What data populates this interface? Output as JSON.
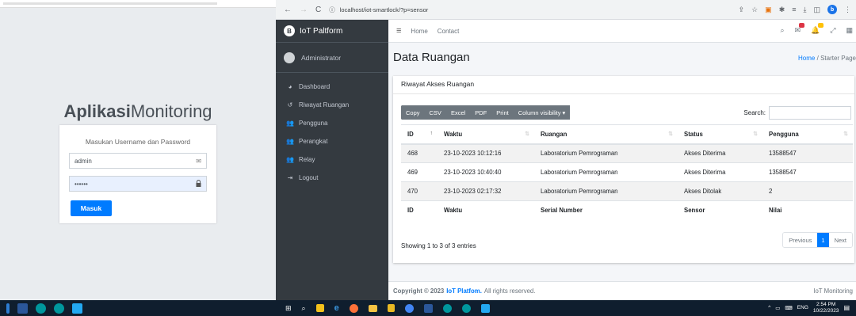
{
  "login": {
    "title_bold": "Aplikasi",
    "title_light": "Monitoring",
    "message": "Masukan Username dan Password",
    "username_value": "admin",
    "password_value": "••••••",
    "submit_label": "Masuk"
  },
  "browser": {
    "url": "localhost/iot-smartlock/?p=sensor",
    "profile_initial": "b"
  },
  "sidebar": {
    "brand": "IoT Paltform",
    "brand_initial": "B",
    "user": "Administrator",
    "items": [
      {
        "label": "Dashboard",
        "icon": "dashboard-icon"
      },
      {
        "label": "Riwayat Ruangan",
        "icon": "history-icon"
      },
      {
        "label": "Pengguna",
        "icon": "users-icon"
      },
      {
        "label": "Perangkat",
        "icon": "devices-icon"
      },
      {
        "label": "Relay",
        "icon": "relay-icon"
      },
      {
        "label": "Logout",
        "icon": "logout-icon"
      }
    ]
  },
  "navbar": {
    "home": "Home",
    "contact": "Contact"
  },
  "page": {
    "title": "Data Ruangan",
    "breadcrumb_home": "Home",
    "breadcrumb_sep": "/",
    "breadcrumb_current": "Starter Page"
  },
  "card": {
    "title": "Riwayat Akses Ruangan",
    "buttons": [
      "Copy",
      "CSV",
      "Excel",
      "PDF",
      "Print",
      "Column visibility ▾"
    ],
    "search_label": "Search:"
  },
  "table": {
    "headers": [
      "ID",
      "Waktu",
      "Ruangan",
      "Status",
      "Pengguna"
    ],
    "rows": [
      [
        "468",
        "23-10-2023 10:12:16",
        "Laboratorium Pemrograman",
        "Akses Diterima",
        "13588547"
      ],
      [
        "469",
        "23-10-2023 10:40:40",
        "Laboratorium Pemrograman",
        "Akses Diterima",
        "13588547"
      ],
      [
        "470",
        "23-10-2023 02:17:32",
        "Laboratorium Pemrograman",
        "Akses Ditolak",
        "2"
      ]
    ],
    "footers": [
      "ID",
      "Waktu",
      "Serial Number",
      "Sensor",
      "Nilai"
    ],
    "info": "Showing 1 to 3 of 3 entries",
    "previous": "Previous",
    "current_page": "1",
    "next": "Next"
  },
  "footer": {
    "copyright": "Copyright © 2023",
    "brand": "IoT Platfom.",
    "rights": "All rights reserved.",
    "right": "IoT Monitoring"
  },
  "taskbar": {
    "lang": "ENG",
    "time": "2:54 PM",
    "date": "10/22/2023"
  }
}
